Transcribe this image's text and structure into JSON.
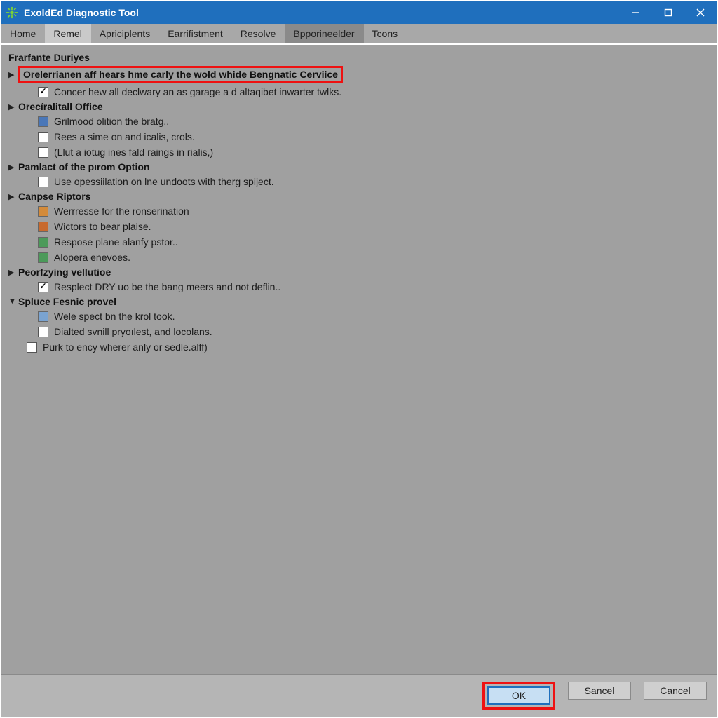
{
  "window": {
    "title": "ExoldEd Diagnostic Tool"
  },
  "tabs": [
    {
      "label": "Home"
    },
    {
      "label": "Remel"
    },
    {
      "label": "Apriciplents"
    },
    {
      "label": "Earrifistment"
    },
    {
      "label": "Resolve"
    },
    {
      "label": "Bpporineelder"
    },
    {
      "label": "Tcons"
    }
  ],
  "section_header": "Frarfante Duriyes",
  "groups": [
    {
      "caret": "▶",
      "title": "Orelerrianen aff hears hme carly the wold whide Bengnatic Cerviice",
      "highlighted": true,
      "items": [
        {
          "type": "checkbox",
          "checked": true,
          "label": "Concer hew all declwary an as garage a d altaqibet inwarter twlks."
        }
      ]
    },
    {
      "caret": "▶",
      "title": "Orecíralitall Office",
      "items": [
        {
          "type": "icon",
          "icon_color": "#4a77b8",
          "label": "Grilmood olition the bratg.."
        },
        {
          "type": "checkbox",
          "checked": false,
          "label": "Rees a sime on and icalis, crols."
        },
        {
          "type": "checkbox",
          "checked": false,
          "label": "(Llut a iotug ines fald raings in rialis,)"
        }
      ]
    },
    {
      "caret": "▶",
      "title": "Pamlact of the pırom Option",
      "items": [
        {
          "type": "checkbox",
          "checked": false,
          "label": "Use opessiilation on lne undoots with therg spiject."
        }
      ]
    },
    {
      "caret": "▶",
      "title": "Canpse Riptors",
      "items": [
        {
          "type": "icon",
          "icon_color": "#d48b3a",
          "label": "Werrresse for the ronserination"
        },
        {
          "type": "icon",
          "icon_color": "#c76a2f",
          "label": "Wictors to bear plaise."
        },
        {
          "type": "icon",
          "icon_color": "#4c9a5a",
          "label": "Respose plane alanfy pstor.."
        },
        {
          "type": "icon",
          "icon_color": "#4c9a5a",
          "label": "Alopera enevoes."
        }
      ]
    },
    {
      "caret": "▶",
      "title": "Peorfzying vellutioe",
      "items": [
        {
          "type": "checkbox",
          "checked": true,
          "label": "Resplect DRY uo be the bang meers and not deflin.."
        }
      ]
    },
    {
      "caret": "▼",
      "title": "Spluce Fesnic provel",
      "items": [
        {
          "type": "icon",
          "icon_color": "#7aa3d0",
          "label": "Wele spect bn the krol took."
        },
        {
          "type": "checkbox",
          "checked": false,
          "label": "Dialted svnill pryoılest, and locolans."
        }
      ]
    }
  ],
  "standalone": {
    "label": "Purk to ency wherer anly or sedle.alff)"
  },
  "footer": {
    "ok": "OK",
    "sancel": "Sancel",
    "cancel": "Cancel"
  }
}
